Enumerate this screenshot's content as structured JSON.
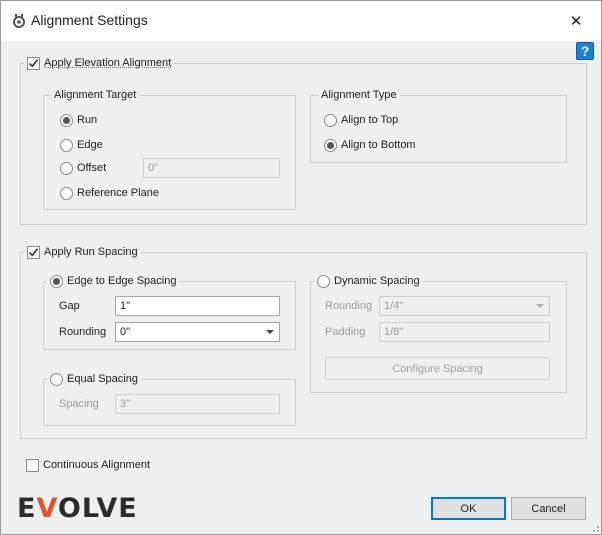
{
  "window": {
    "title": "Alignment Settings",
    "close_label": "✕",
    "help_label": "?"
  },
  "elevation": {
    "checkbox_label": "Apply Elevation Alignment",
    "checked": true,
    "target": {
      "title": "Alignment Target",
      "options": [
        {
          "label": "Run",
          "selected": true
        },
        {
          "label": "Edge",
          "selected": false
        },
        {
          "label": "Offset",
          "selected": false
        },
        {
          "label": "Reference Plane",
          "selected": false
        }
      ],
      "offset_value": "0\""
    },
    "type": {
      "title": "Alignment Type",
      "options": [
        {
          "label": "Align to Top",
          "selected": false
        },
        {
          "label": "Align to Bottom",
          "selected": true
        }
      ]
    }
  },
  "run_spacing": {
    "checkbox_label": "Apply Run Spacing",
    "checked": true,
    "edge": {
      "title": "Edge to Edge Spacing",
      "selected": true,
      "gap_label": "Gap",
      "gap_value": "1\"",
      "rounding_label": "Rounding",
      "rounding_value": "0\""
    },
    "dynamic": {
      "title": "Dynamic Spacing",
      "selected": false,
      "rounding_label": "Rounding",
      "rounding_value": "1/4\"",
      "padding_label": "Padding",
      "padding_value": "1/8\"",
      "configure_label": "Configure Spacing"
    },
    "equal": {
      "title": "Equal Spacing",
      "selected": false,
      "spacing_label": "Spacing",
      "spacing_value": "3\""
    }
  },
  "continuous": {
    "label": "Continuous Alignment",
    "checked": false
  },
  "logo": {
    "pre": "E",
    "mark": "V",
    "post": "OLVE"
  },
  "buttons": {
    "ok": "OK",
    "cancel": "Cancel"
  },
  "colors": {
    "logo_accent": "#e3522a",
    "help_blue": "#1a7fd6",
    "primary_border": "#0078d7"
  }
}
